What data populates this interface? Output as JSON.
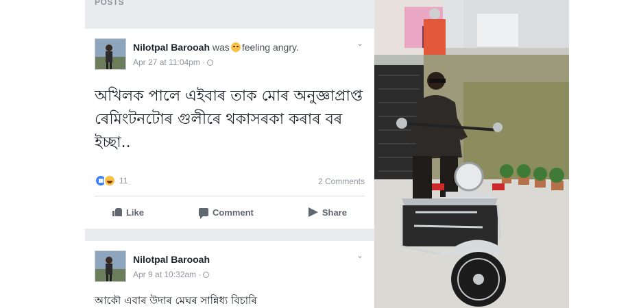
{
  "feed": {
    "section_label": "POSTS",
    "posts": [
      {
        "author": "Nilotpal Barooah",
        "activity_prefix": "was",
        "activity_suffix": "feeling angry.",
        "timestamp": "Apr 27 at 11:04pm",
        "separator": "·",
        "text": "অখিলক পালে এইবাৰ তাক মোৰ অনুজ্ঞাপ্রাপ্ত ৰেমিংটনটোৰ গুলীৰে থকাসৰকা কৰাৰ বৰ ইচ্ছা..",
        "reaction_count": "11",
        "comments": "2 Comments",
        "actions": {
          "like": "Like",
          "comment": "Comment",
          "share": "Share"
        }
      },
      {
        "author": "Nilotpal Barooah",
        "timestamp": "Apr 9 at 10:32am",
        "separator": "·",
        "text": "আকৌ এবাৰ উদাৰ মেঘৰ সান্নিধ্য বিচাৰি"
      }
    ]
  },
  "icons": {
    "feeling": "angry-emoji-icon",
    "privacy": "globe-icon",
    "menu": "chevron-down-icon",
    "reaction_like": "like-reaction-icon",
    "reaction_haha": "haha-reaction-icon",
    "like": "thumbs-up-icon",
    "comment": "comment-icon",
    "share": "share-arrow-icon"
  },
  "colors": {
    "feed_background": "#e9ebee",
    "author_name": "#1d2129",
    "meta_text": "#90949c",
    "like_blue": "#4080ff"
  }
}
